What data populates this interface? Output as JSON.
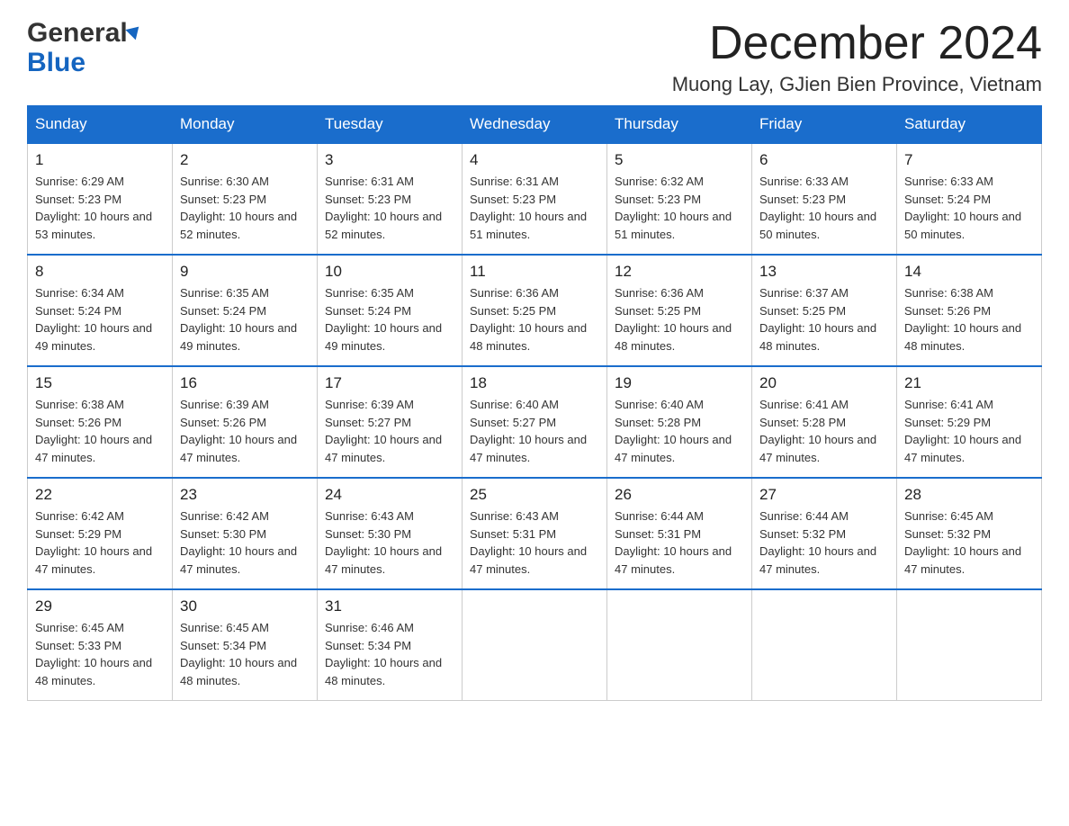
{
  "header": {
    "logo_line1": "General",
    "logo_line2": "Blue",
    "month_title": "December 2024",
    "location": "Muong Lay, GJien Bien Province, Vietnam"
  },
  "days_of_week": [
    "Sunday",
    "Monday",
    "Tuesday",
    "Wednesday",
    "Thursday",
    "Friday",
    "Saturday"
  ],
  "weeks": [
    [
      {
        "day": "1",
        "sunrise": "6:29 AM",
        "sunset": "5:23 PM",
        "daylight": "10 hours and 53 minutes."
      },
      {
        "day": "2",
        "sunrise": "6:30 AM",
        "sunset": "5:23 PM",
        "daylight": "10 hours and 52 minutes."
      },
      {
        "day": "3",
        "sunrise": "6:31 AM",
        "sunset": "5:23 PM",
        "daylight": "10 hours and 52 minutes."
      },
      {
        "day": "4",
        "sunrise": "6:31 AM",
        "sunset": "5:23 PM",
        "daylight": "10 hours and 51 minutes."
      },
      {
        "day": "5",
        "sunrise": "6:32 AM",
        "sunset": "5:23 PM",
        "daylight": "10 hours and 51 minutes."
      },
      {
        "day": "6",
        "sunrise": "6:33 AM",
        "sunset": "5:23 PM",
        "daylight": "10 hours and 50 minutes."
      },
      {
        "day": "7",
        "sunrise": "6:33 AM",
        "sunset": "5:24 PM",
        "daylight": "10 hours and 50 minutes."
      }
    ],
    [
      {
        "day": "8",
        "sunrise": "6:34 AM",
        "sunset": "5:24 PM",
        "daylight": "10 hours and 49 minutes."
      },
      {
        "day": "9",
        "sunrise": "6:35 AM",
        "sunset": "5:24 PM",
        "daylight": "10 hours and 49 minutes."
      },
      {
        "day": "10",
        "sunrise": "6:35 AM",
        "sunset": "5:24 PM",
        "daylight": "10 hours and 49 minutes."
      },
      {
        "day": "11",
        "sunrise": "6:36 AM",
        "sunset": "5:25 PM",
        "daylight": "10 hours and 48 minutes."
      },
      {
        "day": "12",
        "sunrise": "6:36 AM",
        "sunset": "5:25 PM",
        "daylight": "10 hours and 48 minutes."
      },
      {
        "day": "13",
        "sunrise": "6:37 AM",
        "sunset": "5:25 PM",
        "daylight": "10 hours and 48 minutes."
      },
      {
        "day": "14",
        "sunrise": "6:38 AM",
        "sunset": "5:26 PM",
        "daylight": "10 hours and 48 minutes."
      }
    ],
    [
      {
        "day": "15",
        "sunrise": "6:38 AM",
        "sunset": "5:26 PM",
        "daylight": "10 hours and 47 minutes."
      },
      {
        "day": "16",
        "sunrise": "6:39 AM",
        "sunset": "5:26 PM",
        "daylight": "10 hours and 47 minutes."
      },
      {
        "day": "17",
        "sunrise": "6:39 AM",
        "sunset": "5:27 PM",
        "daylight": "10 hours and 47 minutes."
      },
      {
        "day": "18",
        "sunrise": "6:40 AM",
        "sunset": "5:27 PM",
        "daylight": "10 hours and 47 minutes."
      },
      {
        "day": "19",
        "sunrise": "6:40 AM",
        "sunset": "5:28 PM",
        "daylight": "10 hours and 47 minutes."
      },
      {
        "day": "20",
        "sunrise": "6:41 AM",
        "sunset": "5:28 PM",
        "daylight": "10 hours and 47 minutes."
      },
      {
        "day": "21",
        "sunrise": "6:41 AM",
        "sunset": "5:29 PM",
        "daylight": "10 hours and 47 minutes."
      }
    ],
    [
      {
        "day": "22",
        "sunrise": "6:42 AM",
        "sunset": "5:29 PM",
        "daylight": "10 hours and 47 minutes."
      },
      {
        "day": "23",
        "sunrise": "6:42 AM",
        "sunset": "5:30 PM",
        "daylight": "10 hours and 47 minutes."
      },
      {
        "day": "24",
        "sunrise": "6:43 AM",
        "sunset": "5:30 PM",
        "daylight": "10 hours and 47 minutes."
      },
      {
        "day": "25",
        "sunrise": "6:43 AM",
        "sunset": "5:31 PM",
        "daylight": "10 hours and 47 minutes."
      },
      {
        "day": "26",
        "sunrise": "6:44 AM",
        "sunset": "5:31 PM",
        "daylight": "10 hours and 47 minutes."
      },
      {
        "day": "27",
        "sunrise": "6:44 AM",
        "sunset": "5:32 PM",
        "daylight": "10 hours and 47 minutes."
      },
      {
        "day": "28",
        "sunrise": "6:45 AM",
        "sunset": "5:32 PM",
        "daylight": "10 hours and 47 minutes."
      }
    ],
    [
      {
        "day": "29",
        "sunrise": "6:45 AM",
        "sunset": "5:33 PM",
        "daylight": "10 hours and 48 minutes."
      },
      {
        "day": "30",
        "sunrise": "6:45 AM",
        "sunset": "5:34 PM",
        "daylight": "10 hours and 48 minutes."
      },
      {
        "day": "31",
        "sunrise": "6:46 AM",
        "sunset": "5:34 PM",
        "daylight": "10 hours and 48 minutes."
      },
      null,
      null,
      null,
      null
    ]
  ]
}
